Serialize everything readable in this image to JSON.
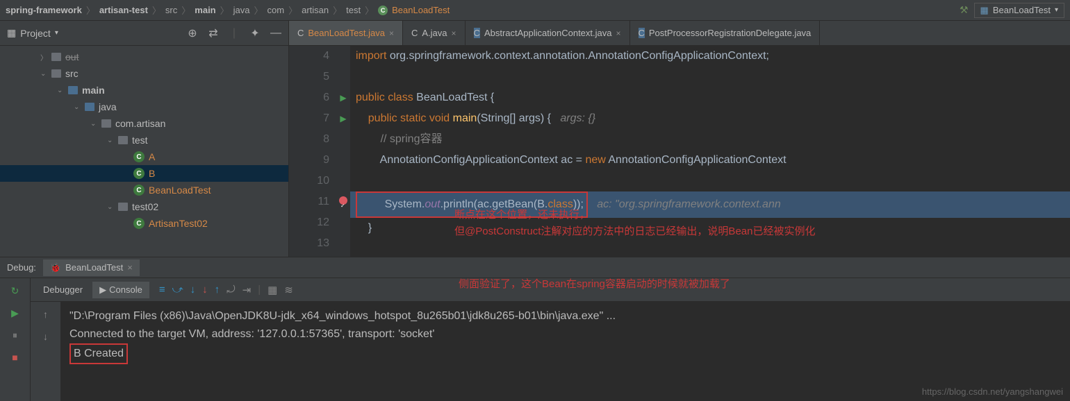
{
  "breadcrumbs": {
    "items": [
      "spring-framework",
      "artisan-test",
      "src",
      "main",
      "java",
      "com",
      "artisan",
      "test",
      "BeanLoadTest"
    ],
    "bold_indices": [
      0,
      1,
      3
    ]
  },
  "run_config": {
    "name": "BeanLoadTest"
  },
  "project": {
    "title": "Project",
    "tree": {
      "out": "out",
      "src": "src",
      "main": "main",
      "java": "java",
      "pkg": "com.artisan",
      "test": "test",
      "a": "A",
      "b": "B",
      "bean_load": "BeanLoadTest",
      "test02": "test02",
      "artisan_test02": "ArtisanTest02"
    }
  },
  "tabs": [
    {
      "name": "BeanLoadTest.java",
      "active": true
    },
    {
      "name": "A.java",
      "active": false
    },
    {
      "name": "AbstractApplicationContext.java",
      "active": false
    },
    {
      "name": "PostProcessorRegistrationDelegate.java",
      "active": false
    }
  ],
  "code": {
    "lines": [
      {
        "n": 4,
        "html": "<span class='kw'>import</span> org.springframework.context.annotation.AnnotationConfigApplicationContext;"
      },
      {
        "n": 5,
        "html": ""
      },
      {
        "n": 6,
        "html": "<span class='kw'>public class</span> BeanLoadTest {",
        "run": true
      },
      {
        "n": 7,
        "html": "    <span class='kw'>public static void</span> <span class='method'>main</span>(String[] args) {   <span class='comment-italic'>args: {}</span>",
        "run": true
      },
      {
        "n": 8,
        "html": "        <span class='comment'>// spring容器</span>"
      },
      {
        "n": 9,
        "html": "        AnnotationConfigApplicationContext ac = <span class='kw'>new</span> AnnotationConfigApplicationContext"
      },
      {
        "n": 10,
        "html": ""
      },
      {
        "n": 11,
        "html": "        System.<span class='field'>out</span>.println(ac.getBean(B.<span class='kw'>class</span>));",
        "bp": true,
        "hint": "ac: \"org.springframework.context.ann"
      },
      {
        "n": 12,
        "html": "    }"
      },
      {
        "n": 13,
        "html": ""
      }
    ]
  },
  "annotations": {
    "l1": "断点在这个位置，还未执行，",
    "l2": "但@PostConstruct注解对应的方法中的日志已经输出，说明Bean已经被实例化",
    "l3": "侧面验证了，这个Bean在spring容器启动的时候就被加载了"
  },
  "debug": {
    "label": "Debug:",
    "tab": "BeanLoadTest",
    "subtabs": {
      "debugger": "Debugger",
      "console": "Console"
    },
    "console": {
      "line1": "\"D:\\Program Files (x86)\\Java\\OpenJDK8U-jdk_x64_windows_hotspot_8u265b01\\jdk8u265-b01\\bin\\java.exe\" ...",
      "line2": "Connected to the target VM, address: '127.0.0.1:57365', transport: 'socket'",
      "line3": "B Created"
    }
  },
  "watermark": "https://blog.csdn.net/yangshangwei"
}
